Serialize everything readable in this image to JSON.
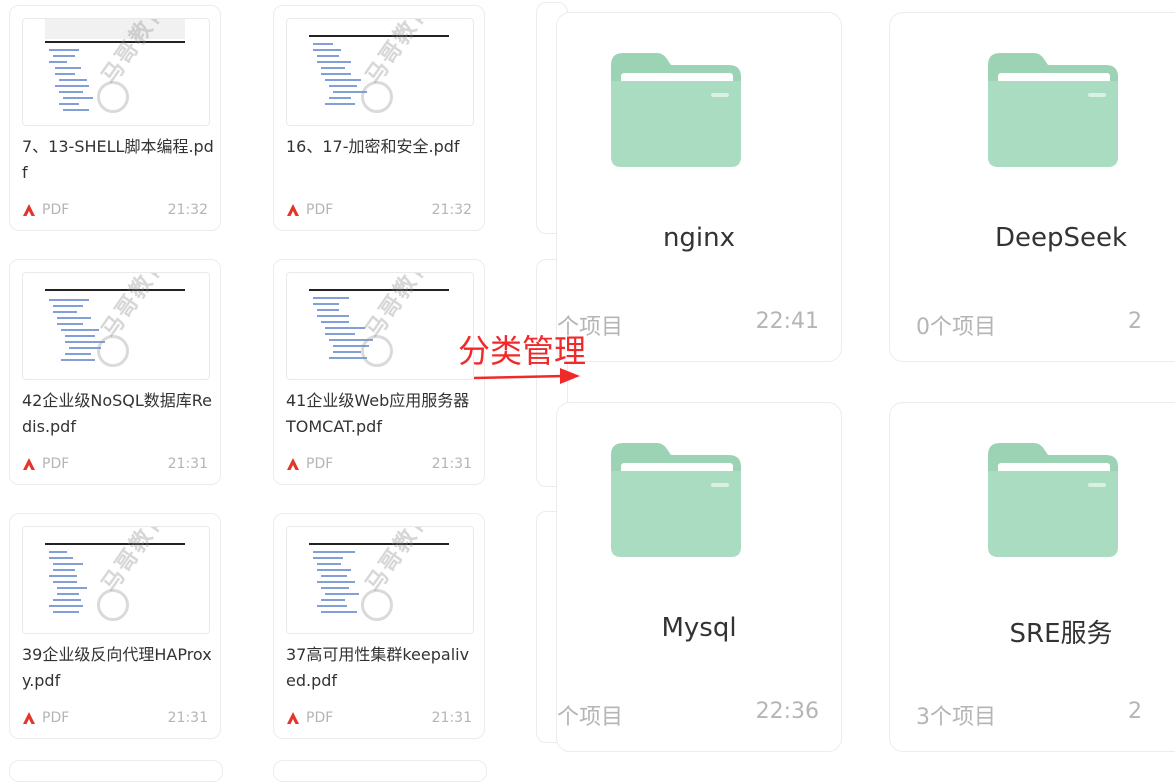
{
  "files": [
    {
      "name": "7、13-SHELL脚本编程.pdf",
      "type": "PDF",
      "time": "21:32"
    },
    {
      "name": "16、17-加密和安全.pdf",
      "type": "PDF",
      "time": "21:32"
    },
    {
      "name": "42企业级NoSQL数据库Redis.pdf",
      "type": "PDF",
      "time": "21:31"
    },
    {
      "name": "41企业级Web应用服务器TOMCAT.pdf",
      "type": "PDF",
      "time": "21:31"
    },
    {
      "name": "39企业级反向代理HAProxy.pdf",
      "type": "PDF",
      "time": "21:31"
    },
    {
      "name": "37高可用性集群keepalived.pdf",
      "type": "PDF",
      "time": "21:31"
    }
  ],
  "folders": [
    {
      "name": "nginx",
      "count": "个项目",
      "time": "22:41"
    },
    {
      "name": "DeepSeek",
      "count": "0个项目",
      "time": "2"
    },
    {
      "name": "Mysql",
      "count": "个项目",
      "time": "22:36"
    },
    {
      "name": "SRE服务",
      "count": "3个项目",
      "time": "2"
    }
  ],
  "annotation": {
    "text": "分类管理",
    "color": "#f02a2a"
  },
  "colors": {
    "folder": "#a9dcc0",
    "folder_back": "#9bd3b4",
    "pdf_icon": "#e2362b"
  },
  "icons": {
    "pdf": "pdf-icon",
    "folder": "folder-icon",
    "arrow": "arrow-icon"
  }
}
